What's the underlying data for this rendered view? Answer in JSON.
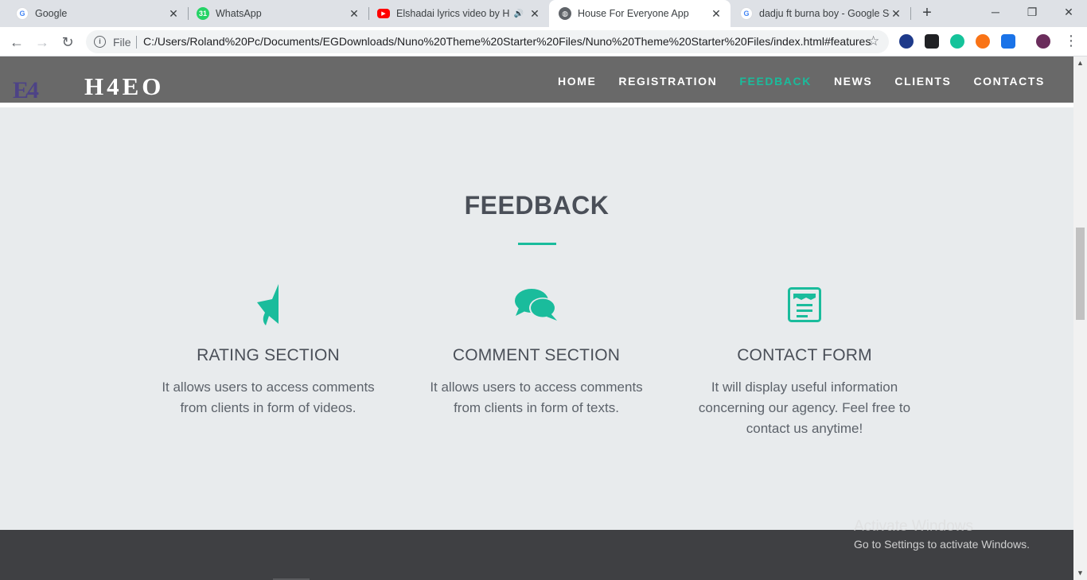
{
  "browser": {
    "tabs": [
      {
        "title": "Google",
        "favicon": "google-icon"
      },
      {
        "title": "WhatsApp",
        "favicon": "whatsapp-icon",
        "badge": "31"
      },
      {
        "title": "Elshadai lyrics video by H-...",
        "favicon": "youtube-icon"
      },
      {
        "title": "House For Everyone App",
        "favicon": "globe-icon"
      },
      {
        "title": "dadju ft burna boy - Google Se...",
        "favicon": "google-icon"
      }
    ],
    "omnibox": {
      "scheme": "File",
      "url": "C:/Users/Roland%20Pc/Documents/EGDownloads/Nuno%20Theme%20Starter%20Files/Nuno%20Theme%20Starter%20Files/index.html#features"
    }
  },
  "site": {
    "logo_text": "H4EO",
    "logo_mark": "E4",
    "nav": [
      {
        "label": "HOME"
      },
      {
        "label": "REGISTRATION"
      },
      {
        "label": "FEEDBACK"
      },
      {
        "label": "NEWS"
      },
      {
        "label": "CLIENTS"
      },
      {
        "label": "CONTACTS"
      }
    ],
    "section_title": "FEEDBACK",
    "features": [
      {
        "icon": "half-star-icon",
        "heading": "RATING SECTION",
        "text": "It allows users to access comments from clients in form of videos."
      },
      {
        "icon": "comments-icon",
        "heading": "COMMENT SECTION",
        "text": "It allows users to access comments from clients in form of texts."
      },
      {
        "icon": "form-icon",
        "heading": "CONTACT FORM",
        "text": "It will display useful information concerning our agency. Feel free to contact us anytime!"
      }
    ]
  },
  "watermark": {
    "title": "Activate Windows",
    "subtitle": "Go to Settings to activate Windows."
  },
  "colors": {
    "accent": "#1abc9c",
    "nav_bg": "#696969",
    "page_bg": "#e8ebed",
    "footer_bg": "#3f4043"
  }
}
